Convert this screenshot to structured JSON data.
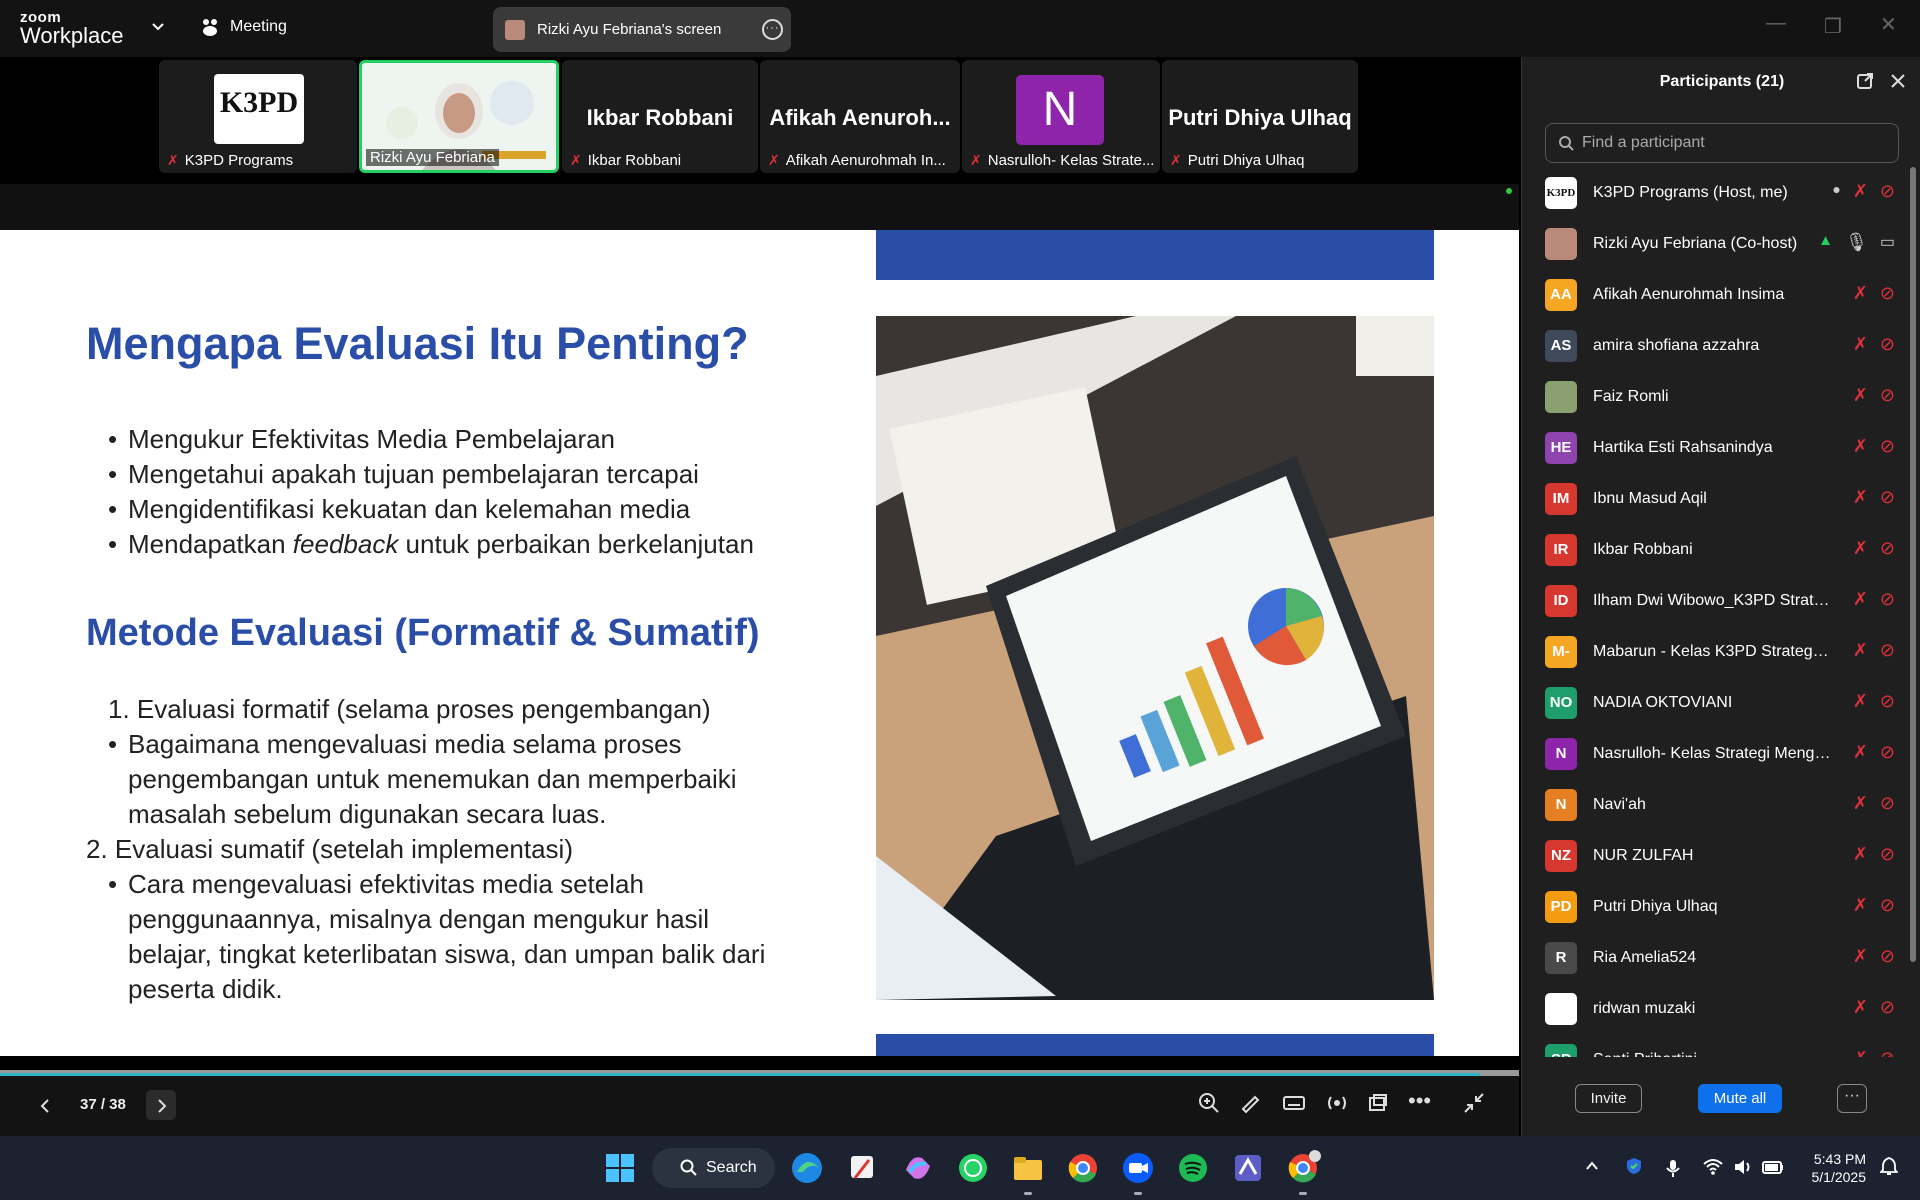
{
  "app": {
    "logo_top": "zoom",
    "logo_bottom": "Workplace",
    "meeting_label": "Meeting",
    "share_pill": "Rizki Ayu Febriana's screen"
  },
  "gallery": [
    {
      "name": "K3PD Programs",
      "logo_text": "K3PD"
    },
    {
      "name": "Rizki Ayu Febriana"
    },
    {
      "name": "Ikbar Robbani",
      "big": "Ikbar Robbani"
    },
    {
      "name": "Afikah Aenurohmah In...",
      "big": "Afikah  Aenuroh..."
    },
    {
      "name": "Nasrulloh- Kelas Strate...",
      "initial": "N"
    },
    {
      "name": "Putri Dhiya Ulhaq",
      "big": "Putri Dhiya Ulhaq"
    }
  ],
  "slide": {
    "heading1": "Mengapa Evaluasi Itu Penting?",
    "bullets1": [
      "Mengukur Efektivitas Media Pembelajaran",
      "Mengetahui apakah tujuan pembelajaran tercapai",
      "Mengidentifikasi kekuatan dan kelemahan media"
    ],
    "bullet4_pre": "Mendapatkan ",
    "bullet4_em": "feedback",
    "bullet4_post": " untuk perbaikan berkelanjutan",
    "heading2": "Metode Evaluasi (Formatif & Sumatif)",
    "item1": "1. Evaluasi formatif (selama proses pengembangan)",
    "item1_sub": "Bagaimana mengevaluasi media selama proses pengembangan untuk menemukan dan memperbaiki masalah sebelum digunakan secara luas.",
    "item2": "2. Evaluasi sumatif (setelah implementasi)",
    "item2_sub": "Cara mengevaluasi efektivitas media setelah penggunaannya, misalnya dengan mengukur hasil belajar, tingkat keterlibatan siswa, dan umpan balik dari peserta didik."
  },
  "controls": {
    "page_indicator": "37 / 38",
    "progress_fraction": 0.974
  },
  "participants": {
    "title": "Participants (21)",
    "search_placeholder": "Find a participant",
    "invite_label": "Invite",
    "mute_all_label": "Mute all",
    "more_label": "···",
    "list": [
      {
        "name": "K3PD Programs (Host, me)",
        "initials": "K3PD",
        "color": "#ffffff",
        "text_color": "#111111"
      },
      {
        "name": "Rizki Ayu Febriana (Co-host)",
        "initials": "",
        "color": "#b98a7a",
        "text_color": "#ffffff"
      },
      {
        "name": "Afikah Aenurohmah Insima",
        "initials": "AA",
        "color": "#f5a623",
        "text_color": "#ffffff"
      },
      {
        "name": "amira shofiana azzahra",
        "initials": "AS",
        "color": "#3e4a5a",
        "text_color": "#ffffff"
      },
      {
        "name": "Faiz Romli",
        "initials": "",
        "color": "#8aa070",
        "text_color": "#ffffff"
      },
      {
        "name": "Hartika Esti Rahsanindya",
        "initials": "HE",
        "color": "#8e44ad",
        "text_color": "#ffffff"
      },
      {
        "name": "Ibnu Masud Aqil",
        "initials": "IM",
        "color": "#d6382f",
        "text_color": "#ffffff"
      },
      {
        "name": "Ikbar Robbani",
        "initials": "IR",
        "color": "#d6382f",
        "text_color": "#ffffff"
      },
      {
        "name": "Ilham Dwi Wibowo_K3PD Strate...",
        "initials": "ID",
        "color": "#d6382f",
        "text_color": "#ffffff"
      },
      {
        "name": "Mabarun - Kelas K3PD Strategi ...",
        "initials": "M-",
        "color": "#f5a623",
        "text_color": "#ffffff"
      },
      {
        "name": "NADIA OKTOVIANI",
        "initials": "NO",
        "color": "#1e9e6b",
        "text_color": "#ffffff"
      },
      {
        "name": "Nasrulloh- Kelas Strategi Mengaj...",
        "initials": "N",
        "color": "#8e24aa",
        "text_color": "#ffffff"
      },
      {
        "name": "Navi'ah",
        "initials": "N",
        "color": "#e67e22",
        "text_color": "#ffffff"
      },
      {
        "name": "NUR ZULFAH",
        "initials": "NZ",
        "color": "#d6382f",
        "text_color": "#ffffff"
      },
      {
        "name": "Putri Dhiya Ulhaq",
        "initials": "PD",
        "color": "#f39c12",
        "text_color": "#ffffff"
      },
      {
        "name": "Ria Amelia524",
        "initials": "R",
        "color": "#4a4a4a",
        "text_color": "#ffffff"
      },
      {
        "name": "ridwan muzaki",
        "initials": "",
        "color": "#ffffff",
        "text_color": "#111111"
      },
      {
        "name": "Santi Prihartini",
        "initials": "SP",
        "color": "#1e9e6b",
        "text_color": "#ffffff"
      }
    ]
  },
  "taskbar": {
    "search_label": "Search",
    "time": "5:43 PM",
    "date": "5/1/2025"
  },
  "colors": {
    "slide_blue": "#2a4ea8",
    "accent_blue": "#0e71eb",
    "mute_red": "#e0303a"
  }
}
